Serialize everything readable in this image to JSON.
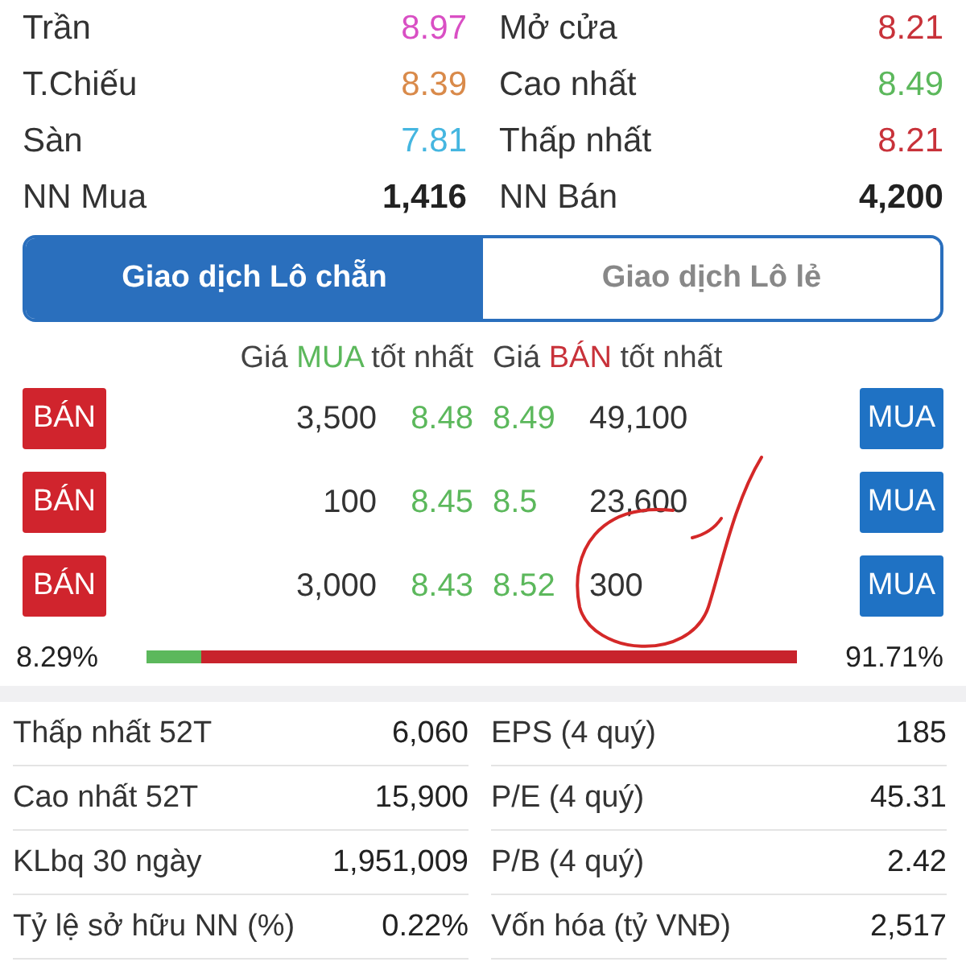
{
  "quote": [
    {
      "label": "Trần",
      "value": "8.97",
      "color": "#d94fc4",
      "bold": false
    },
    {
      "label": "Mở cửa",
      "value": "8.21",
      "color": "#c8323a",
      "bold": false
    },
    {
      "label": "T.Chiếu",
      "value": "8.39",
      "color": "#d98a4a",
      "bold": false
    },
    {
      "label": "Cao nhất",
      "value": "8.49",
      "color": "#5cb85c",
      "bold": false
    },
    {
      "label": "Sàn",
      "value": "7.81",
      "color": "#45b6e0",
      "bold": false
    },
    {
      "label": "Thấp nhất",
      "value": "8.21",
      "color": "#c8323a",
      "bold": false
    },
    {
      "label": "NN Mua",
      "value": "1,416",
      "color": "#222222",
      "bold": true
    },
    {
      "label": "NN Bán",
      "value": "4,200",
      "color": "#222222",
      "bold": true
    }
  ],
  "tabs": [
    {
      "label": "Giao dịch Lô chẵn",
      "selected": true
    },
    {
      "label": "Giao dịch Lô lẻ",
      "selected": false
    }
  ],
  "book_header": {
    "buy": {
      "pre": "Giá",
      "side": "MUA",
      "post": "tốt nhất"
    },
    "sell": {
      "pre": "Giá",
      "side": "BÁN",
      "post": "tốt nhất"
    }
  },
  "book": [
    {
      "sell_button": "BÁN",
      "bid_volume": "3,500",
      "bid": "8.48",
      "ask": "8.49",
      "ask_volume": "49,100",
      "buy_button": "MUA"
    },
    {
      "sell_button": "BÁN",
      "bid_volume": "100",
      "bid": "8.45",
      "ask": "8.5",
      "ask_volume": "23,600",
      "buy_button": "MUA"
    },
    {
      "sell_button": "BÁN",
      "bid_volume": "3,000",
      "bid": "8.43",
      "ask": "8.52",
      "ask_volume": "300",
      "buy_button": "MUA"
    }
  ],
  "balance": {
    "buy_label": "8.29%",
    "sell_label": "91.71%",
    "level": 0.0829
  },
  "stats": [
    {
      "label": "Thấp nhất 52T",
      "value": "6,060"
    },
    {
      "label": "EPS (4 quý)",
      "value": "185"
    },
    {
      "label": "Cao nhất 52T",
      "value": "15,900"
    },
    {
      "label": "P/E (4 quý)",
      "value": "45.31"
    },
    {
      "label": "KLbq 30 ngày",
      "value": "1,951,009"
    },
    {
      "label": "P/B (4 quý)",
      "value": "2.42"
    },
    {
      "label": "Tỷ lệ sở hữu NN (%)",
      "value": "0.22%"
    },
    {
      "label": "Vốn hóa (tỷ VNĐ)",
      "value": "2,517"
    }
  ]
}
